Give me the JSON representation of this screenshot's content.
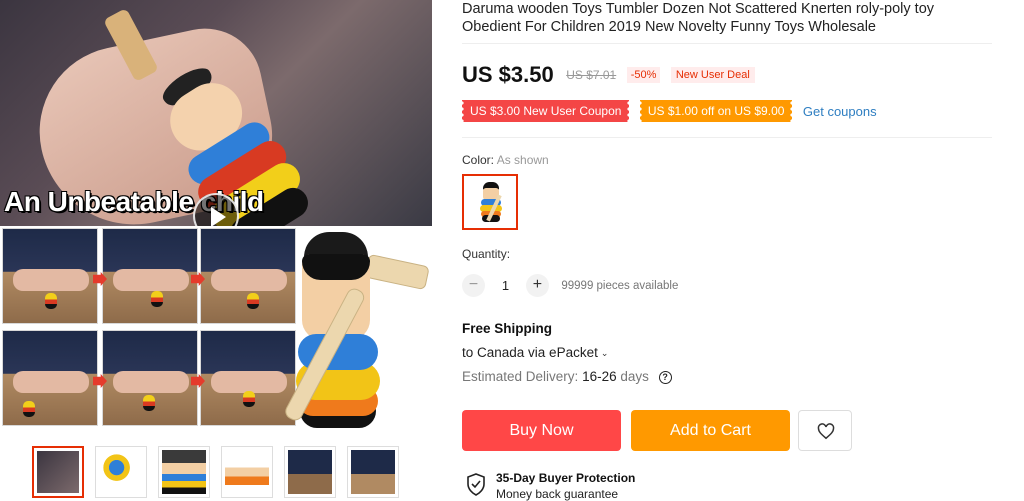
{
  "product": {
    "title": "Daruma wooden Toys Tumbler Dozen Not Scattered Knerten roly-poly toy Obedient For Children 2019 New Novelty Funny Toys Wholesale",
    "image_caption": "An Unbeatable child"
  },
  "pricing": {
    "price": "US $3.50",
    "original_price": "US $7.01",
    "discount": "-50%",
    "deal_badge": "New User Deal"
  },
  "coupons": {
    "coupon1": "US $3.00 New User Coupon",
    "coupon2": "US $1.00 off on US $9.00",
    "get_coupons": "Get coupons"
  },
  "color": {
    "label": "Color:",
    "value": "As shown"
  },
  "quantity": {
    "label": "Quantity:",
    "value": "1",
    "minus": "−",
    "plus": "+",
    "available": "99999 pieces available"
  },
  "shipping": {
    "title": "Free Shipping",
    "destination": "to Canada via ePacket",
    "delivery_label": "Estimated Delivery:",
    "delivery_value": "16-26",
    "delivery_unit": "days"
  },
  "actions": {
    "buy_now": "Buy Now",
    "add_to_cart": "Add to Cart"
  },
  "protection": {
    "title": "35-Day Buyer Protection",
    "subtitle": "Money back guarantee"
  },
  "gallery": {
    "thumb_count": 6,
    "selected_index": 0
  },
  "colors": {
    "accent_red": "#ff4747",
    "accent_orange": "#ff9900",
    "link_blue": "#2e7ec1",
    "badge_red": "#e62e04"
  },
  "icons": {
    "play": "play-icon",
    "wishlist": "heart-icon",
    "help": "question-circle-icon",
    "protection": "shield-check-icon",
    "dropdown": "chevron-down-icon"
  }
}
